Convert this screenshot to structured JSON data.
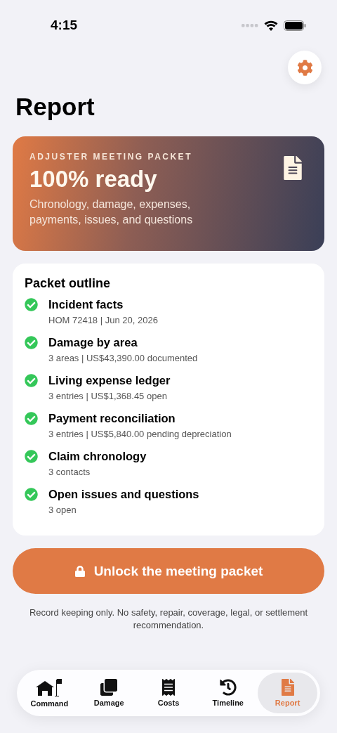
{
  "status_bar": {
    "time": "4:15"
  },
  "title": "Report",
  "hero": {
    "eyebrow": "ADJUSTER MEETING PACKET",
    "headline": "100% ready",
    "description": "Chronology, damage, expenses, payments, issues, and questions"
  },
  "outline": {
    "title": "Packet outline",
    "items": [
      {
        "title": "Incident facts",
        "detail": "HOM 72418 | Jun 20, 2026",
        "done": true
      },
      {
        "title": "Damage by area",
        "detail": "3 areas | US$43,390.00 documented",
        "done": true
      },
      {
        "title": "Living expense ledger",
        "detail": "3 entries | US$1,368.45 open",
        "done": true
      },
      {
        "title": "Payment reconciliation",
        "detail": "3 entries | US$5,840.00 pending depreciation",
        "done": true
      },
      {
        "title": "Claim chronology",
        "detail": "3 contacts",
        "done": true
      },
      {
        "title": "Open issues and questions",
        "detail": "3 open",
        "done": true
      }
    ]
  },
  "unlock_button": {
    "label": "Unlock the meeting packet"
  },
  "disclaimer": "Record keeping only. No safety, repair, coverage, legal, or settlement recommendation.",
  "tabs": [
    {
      "kind": "command",
      "label": "Command",
      "selected": false
    },
    {
      "kind": "damage",
      "label": "Damage",
      "selected": false
    },
    {
      "kind": "costs",
      "label": "Costs",
      "selected": false
    },
    {
      "kind": "timeline",
      "label": "Timeline",
      "selected": false
    },
    {
      "kind": "report",
      "label": "Report",
      "selected": true
    }
  ]
}
